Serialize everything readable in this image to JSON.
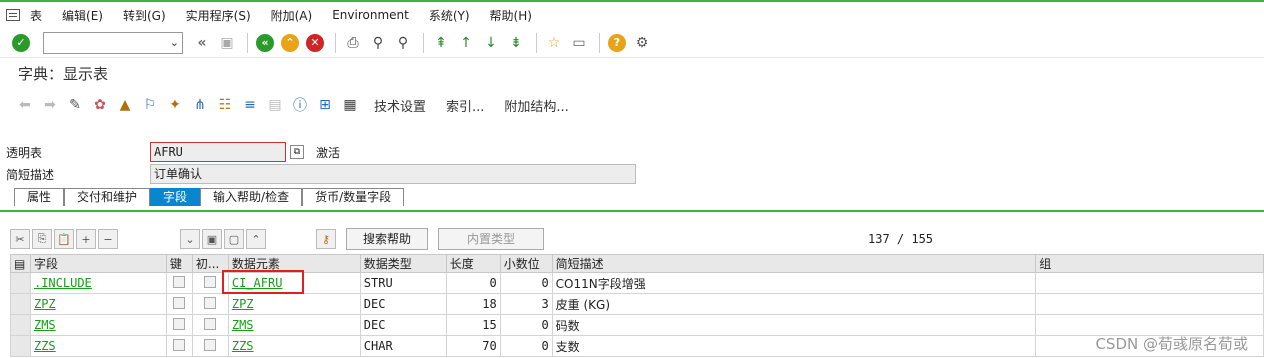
{
  "menu": [
    "表",
    "编辑(E)",
    "转到(G)",
    "实用程序(S)",
    "附加(A)",
    "Environment",
    "系统(Y)",
    "帮助(H)"
  ],
  "title": "字典：显示表",
  "toolbar2_text": [
    "技术设置",
    "索引...",
    "附加结构..."
  ],
  "form": {
    "table_label": "透明表",
    "table_value": "AFRU",
    "status": "激活",
    "desc_label": "简短描述",
    "desc_value": "订单确认"
  },
  "tabs": [
    "属性",
    "交付和维护",
    "字段",
    "输入帮助/检查",
    "货币/数量字段"
  ],
  "search_help": "搜索帮助",
  "builtin_type": "内置类型",
  "counter": "137 / 155",
  "columns": [
    "字段",
    "键",
    "初...",
    "数据元素",
    "数据类型",
    "长度",
    "小数位",
    "简短描述",
    "组"
  ],
  "rows": [
    {
      "field": ".INCLUDE",
      "element": "CI_AFRU",
      "type": "STRU",
      "len": "0",
      "dec": "0",
      "desc": "CO11N字段增强"
    },
    {
      "field": "ZPZ",
      "element": "ZPZ",
      "type": "DEC",
      "len": "18",
      "dec": "3",
      "desc": "皮重 (KG)"
    },
    {
      "field": "ZMS",
      "element": "ZMS",
      "type": "DEC",
      "len": "15",
      "dec": "0",
      "desc": "码数"
    },
    {
      "field": "ZZS",
      "element": "ZZS",
      "type": "CHAR",
      "len": "70",
      "dec": "0",
      "desc": "支数"
    }
  ],
  "watermark": "CSDN @荀彧原名荀或"
}
